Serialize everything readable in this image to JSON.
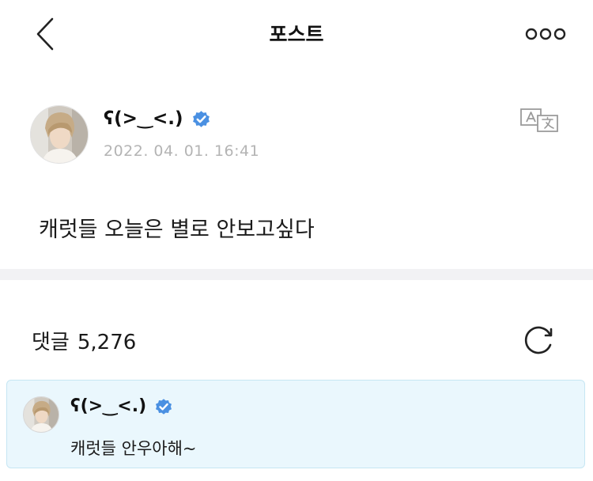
{
  "header": {
    "title": "포스트",
    "back_icon": "chevron-left-icon",
    "more_icon": "more-horizontal-icon"
  },
  "post": {
    "author": "ʕ(>‿<.)",
    "verified_icon": "verified-badge-icon",
    "timestamp": "2022. 04. 01. 16:41",
    "translate_icon": "translate-icon",
    "text": "캐럿들 오늘은 별로 안보고싶다"
  },
  "comments": {
    "label": "댓글",
    "count": "5,276",
    "refresh_icon": "refresh-icon",
    "items": [
      {
        "author": "ʕ(>‿<.)",
        "text": "캐럿들 안우아해~"
      }
    ]
  },
  "colors": {
    "verified": "#4a90e2",
    "timestamp": "#b4b4b4",
    "highlight_bg": "#eaf7fd",
    "highlight_border": "#c6e6f3",
    "divider": "#f2f2f4"
  }
}
